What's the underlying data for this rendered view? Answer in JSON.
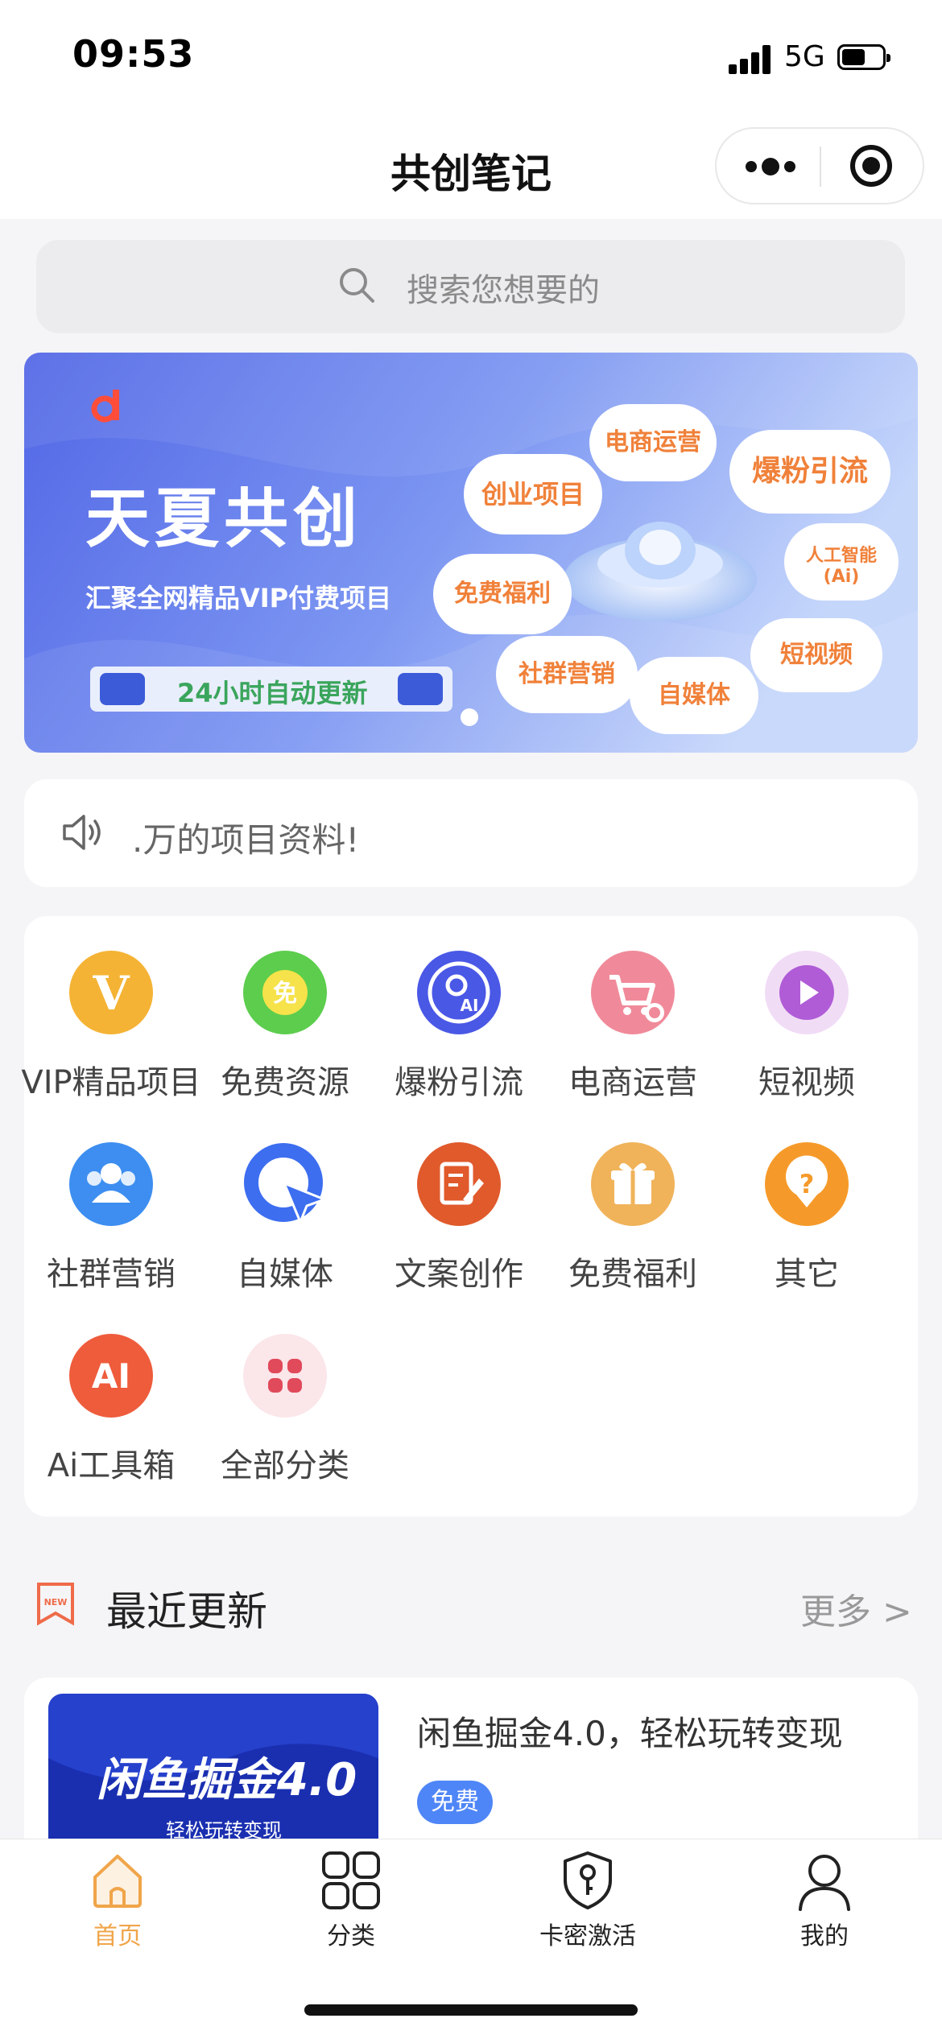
{
  "status_bar": {
    "time": "09:53",
    "network": "5G"
  },
  "nav": {
    "title": "共创笔记"
  },
  "search": {
    "placeholder": "搜索您想要的"
  },
  "banner": {
    "brand_mark": "d",
    "title": "天夏共创",
    "subtitle": "汇聚全网精品VIP付费项目",
    "badge": "24小时自动更新",
    "bubbles": [
      "电商运营",
      "爆粉引流",
      "创业项目",
      "人工智能",
      "(Ai)",
      "免费福利",
      "短视频",
      "社群营销",
      "自媒体"
    ]
  },
  "notice": {
    "text": ".万的项目资料!"
  },
  "categories": [
    {
      "label": "VIP精品项目",
      "icon": "vip-icon",
      "color": "#f5b335"
    },
    {
      "label": "免费资源",
      "icon": "free-icon",
      "color": "#5ccd4d"
    },
    {
      "label": "爆粉引流",
      "icon": "ai-user-icon",
      "color": "#4a58e6"
    },
    {
      "label": "电商运营",
      "icon": "cart-icon",
      "color": "#f08a9a"
    },
    {
      "label": "短视频",
      "icon": "play-icon",
      "color": "#b05cd6"
    },
    {
      "label": "社群营销",
      "icon": "group-icon",
      "color": "#3d8ef0"
    },
    {
      "label": "自媒体",
      "icon": "cursor-icon",
      "color": "#3d6ef0"
    },
    {
      "label": "文案创作",
      "icon": "edit-icon",
      "color": "#e05a2c"
    },
    {
      "label": "免费福利",
      "icon": "gift-icon",
      "color": "#f0b35a"
    },
    {
      "label": "其它",
      "icon": "question-icon",
      "color": "#f59a2a"
    },
    {
      "label": "Ai工具箱",
      "icon": "ai-icon",
      "color": "#ee5c3c"
    },
    {
      "label": "全部分类",
      "icon": "clover-icon",
      "color": "#e04a5a"
    }
  ],
  "recent": {
    "title": "最近更新",
    "more": "更多 >",
    "new_badge": "NEW",
    "items": [
      {
        "title": "闲鱼掘金4.0，轻松玩转变现",
        "tag": "免费",
        "thumb_title": "闲鱼掘金4.0",
        "thumb_sub": "轻松玩转变现"
      }
    ]
  },
  "tabs": [
    {
      "label": "首页",
      "icon": "home-icon",
      "active": true
    },
    {
      "label": "分类",
      "icon": "grid-icon",
      "active": false
    },
    {
      "label": "卡密激活",
      "icon": "shield-key-icon",
      "active": false
    },
    {
      "label": "我的",
      "icon": "person-icon",
      "active": false
    }
  ],
  "colors": {
    "accent": "#f0a54a",
    "tag_blue": "#4f86f7",
    "banner_blue": "#5a78ea"
  }
}
